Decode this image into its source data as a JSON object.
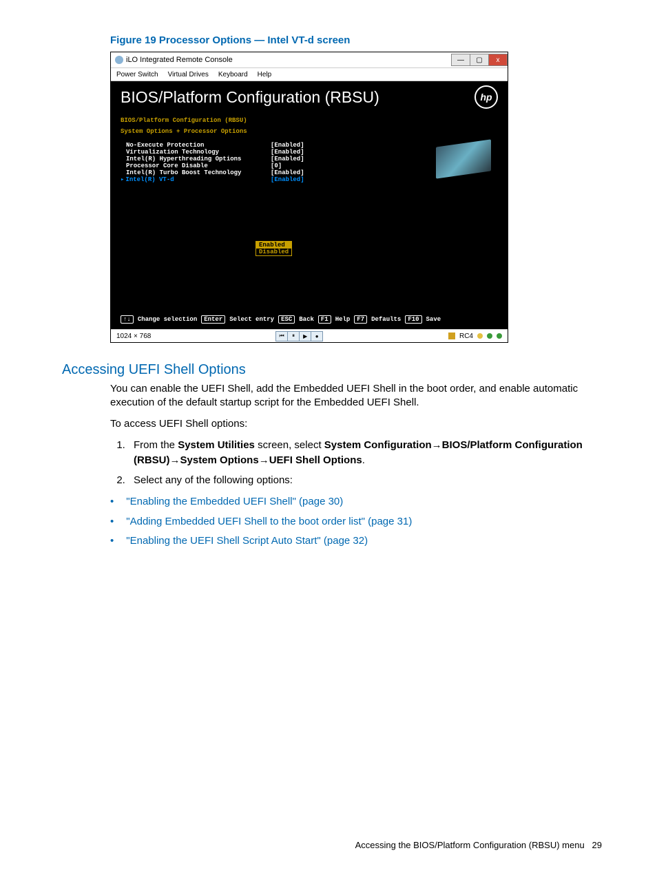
{
  "figure_caption": "Figure 19 Processor Options — Intel VT-d screen",
  "window": {
    "title": "iLO Integrated Remote Console",
    "menus": [
      "Power Switch",
      "Virtual Drives",
      "Keyboard",
      "Help"
    ],
    "min_label": "—",
    "max_label": "▢",
    "close_label": "x"
  },
  "bios": {
    "title": "BIOS/Platform Configuration (RBSU)",
    "logo_text": "hp",
    "crumb1": "BIOS/Platform Configuration (RBSU)",
    "crumb2": "System Options + Processor Options",
    "options": [
      {
        "name": "No-Execute Protection",
        "value": "[Enabled]"
      },
      {
        "name": "Virtualization Technology",
        "value": "[Enabled]"
      },
      {
        "name": "Intel(R) Hyperthreading Options",
        "value": "[Enabled]"
      },
      {
        "name": "Processor Core Disable",
        "value": "[0]"
      },
      {
        "name": "Intel(R) Turbo Boost Technology",
        "value": "[Enabled]"
      },
      {
        "name": "Intel(R) VT-d",
        "value": "[Enabled]"
      }
    ],
    "picker": {
      "enabled": "Enabled",
      "disabled": "Disabled"
    },
    "footer": {
      "k1": "↑↓",
      "l1": "Change selection",
      "k2": "Enter",
      "l2": "Select entry",
      "k3": "ESC",
      "l3": "Back",
      "k4": "F1",
      "l4": "Help",
      "k5": "F7",
      "l5": "Defaults",
      "k6": "F10",
      "l6": "Save"
    }
  },
  "statusbar": {
    "resolution": "1024 × 768",
    "rc_label": "RC4"
  },
  "section_heading": "Accessing UEFI Shell Options",
  "para1": "You can enable the UEFI Shell, add the Embedded UEFI Shell in the boot order, and enable automatic execution of the default startup script for the Embedded UEFI Shell.",
  "para2": "To access UEFI Shell options:",
  "step1": {
    "prefix": "From the ",
    "b1": "System Utilities",
    "mid1": " screen, select ",
    "b2": "System Configuration",
    "arrow1": "→",
    "b3": "BIOS/Platform Configuration (RBSU)",
    "arrow2": "→",
    "b4": "System Options",
    "arrow3": "→",
    "b5": "UEFI Shell Options",
    "suffix": "."
  },
  "step2": "Select any of the following options:",
  "links": [
    "\"Enabling the Embedded UEFI Shell\" (page 30)",
    "\"Adding Embedded UEFI Shell to the boot order list\" (page 31)",
    "\"Enabling the UEFI Shell Script Auto Start\" (page 32)"
  ],
  "footer": {
    "text": "Accessing the BIOS/Platform Configuration (RBSU) menu",
    "page": "29"
  }
}
